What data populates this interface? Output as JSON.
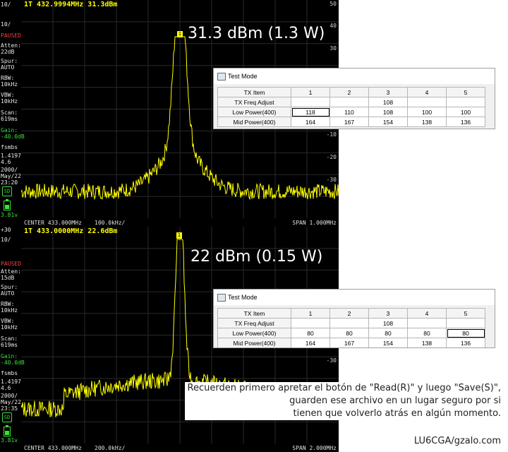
{
  "panels": {
    "top": {
      "marker_readout": "1T 432.9994MHz 31.3dBm",
      "sidebar": {
        "scale": "10/",
        "mode": "PAUSED",
        "atten_label": "Atten:",
        "atten_value": "22dB",
        "spur_label": "Spur:",
        "spur_value": "AUTO",
        "rbw_label": "RBW:",
        "rbw_value": "10kHz",
        "vbw_label": "VBW:",
        "vbw_value": "10kHz",
        "scan_label": "Scan:",
        "scan_value": "619ms",
        "gain_label": "Gain:",
        "gain_value": "-40.0dB",
        "fw_label": "fsmbs",
        "version_a": "1.4197",
        "version_b": "4.6",
        "date_a": "2000/",
        "date_b": "May/22",
        "time": "23:20",
        "sd_label": "SD",
        "battery": "3.81v"
      },
      "y_labels": [
        "50",
        "40",
        "30",
        "-10",
        "-20",
        "-30"
      ],
      "center": "CENTER 433.000MHz",
      "rbw_footer": "100.0kHz/",
      "span": "SPAN 1.000MHz",
      "callout": "31.3 dBm (1.3 W)",
      "dialog": {
        "title": "Test Mode",
        "headers": [
          "TX Item",
          "1",
          "2",
          "3",
          "4",
          "5"
        ],
        "rows": [
          [
            "TX Freq Adjust",
            "",
            "",
            "108",
            "",
            ""
          ],
          [
            "Low Power(400)",
            "118",
            "110",
            "108",
            "100",
            "100"
          ],
          [
            "Mid Power(400)",
            "164",
            "167",
            "154",
            "138",
            "136"
          ]
        ]
      }
    },
    "bottom": {
      "marker_readout": "1T 433.0000MHz 22.6dBm",
      "sidebar": {
        "scale": "10/",
        "mode": "PAUSED",
        "atten_label": "Atten:",
        "atten_value": "15dB",
        "spur_label": "Spur:",
        "spur_value": "AUTO",
        "rbw_label": "RBW:",
        "rbw_value": "10kHz",
        "vbw_label": "VBW:",
        "vbw_value": "10kHz",
        "scan_label": "Scan:",
        "scan_value": "619ms",
        "gain_label": "Gain:",
        "gain_value": "-40.0dB",
        "fw_label": "fsmbs",
        "version_a": "1.4197",
        "version_b": "4.6",
        "date_a": "2000/",
        "date_b": "May/22",
        "time": "23:35",
        "sd_label": "SD",
        "battery": "3.81v",
        "top_ref": "+30"
      },
      "y_labels": [
        "-30"
      ],
      "center": "CENTER 433.000MHz",
      "rbw_footer": "200.0kHz/",
      "span": "SPAN 2.000MHz",
      "callout": "22 dBm (0.15 W)",
      "dialog": {
        "title": "Test Mode",
        "headers": [
          "TX Item",
          "1",
          "2",
          "3",
          "4",
          "5"
        ],
        "rows": [
          [
            "TX Freq Adjust",
            "",
            "",
            "108",
            "",
            ""
          ],
          [
            "Low Power(400)",
            "80",
            "80",
            "80",
            "80",
            "80"
          ],
          [
            "Mid Power(400)",
            "164",
            "167",
            "154",
            "138",
            "136"
          ]
        ]
      }
    }
  },
  "note": {
    "line1": "Recuerden primero apretar el botón de \"Read(R)\" y luego \"Save(S)\",",
    "line2": "guarden ese archivo en un lugar seguro por si",
    "line3": "tienen que volverlo atrás en algún momento."
  },
  "credit": "LU6CGA/gzalo.com",
  "colors": {
    "trace": "#ffff00",
    "background": "#000000",
    "gain": "#3be03b",
    "paused": "#ff3b3b"
  },
  "icons": {
    "sd": "sd-card-icon",
    "battery": "battery-icon",
    "marker": "marker-flag-icon",
    "dialog": "app-window-icon"
  }
}
